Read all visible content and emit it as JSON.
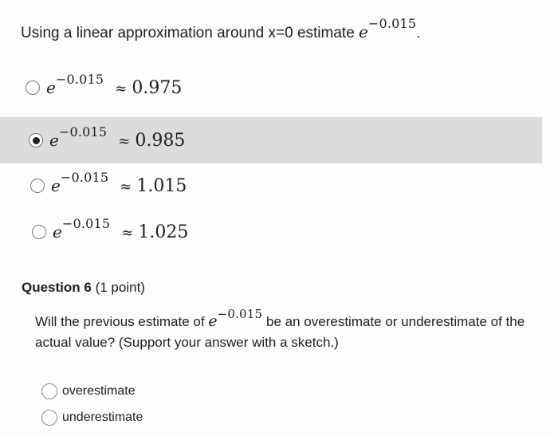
{
  "question5": {
    "prompt": "Using a linear approximation around x=0 estimate",
    "base": "e",
    "exponent": "−0.015",
    "end_punct": ".",
    "options": [
      {
        "base": "e",
        "exponent": "−0.015",
        "approx": "≈",
        "value": "0.975",
        "selected": false
      },
      {
        "base": "e",
        "exponent": "−0.015",
        "approx": "≈",
        "value": "0.985",
        "selected": true
      },
      {
        "base": "e",
        "exponent": "−0.015",
        "approx": "≈",
        "value": "1.015",
        "selected": false
      },
      {
        "base": "e",
        "exponent": "−0.015",
        "approx": "≈",
        "value": "1.025",
        "selected": false
      }
    ]
  },
  "question6": {
    "title": "Question 6",
    "points": "(1 point)",
    "text_before": "Will the previous estimate of",
    "base": "e",
    "exponent": "−0.015",
    "text_after": "be an overestimate or underestimate of the actual value? (Support your answer with a sketch.)",
    "answers": [
      {
        "label": "overestimate"
      },
      {
        "label": "underestimate"
      }
    ]
  },
  "colors": {
    "selected_row_bg": "#dcdcdc",
    "text": "#202020"
  }
}
